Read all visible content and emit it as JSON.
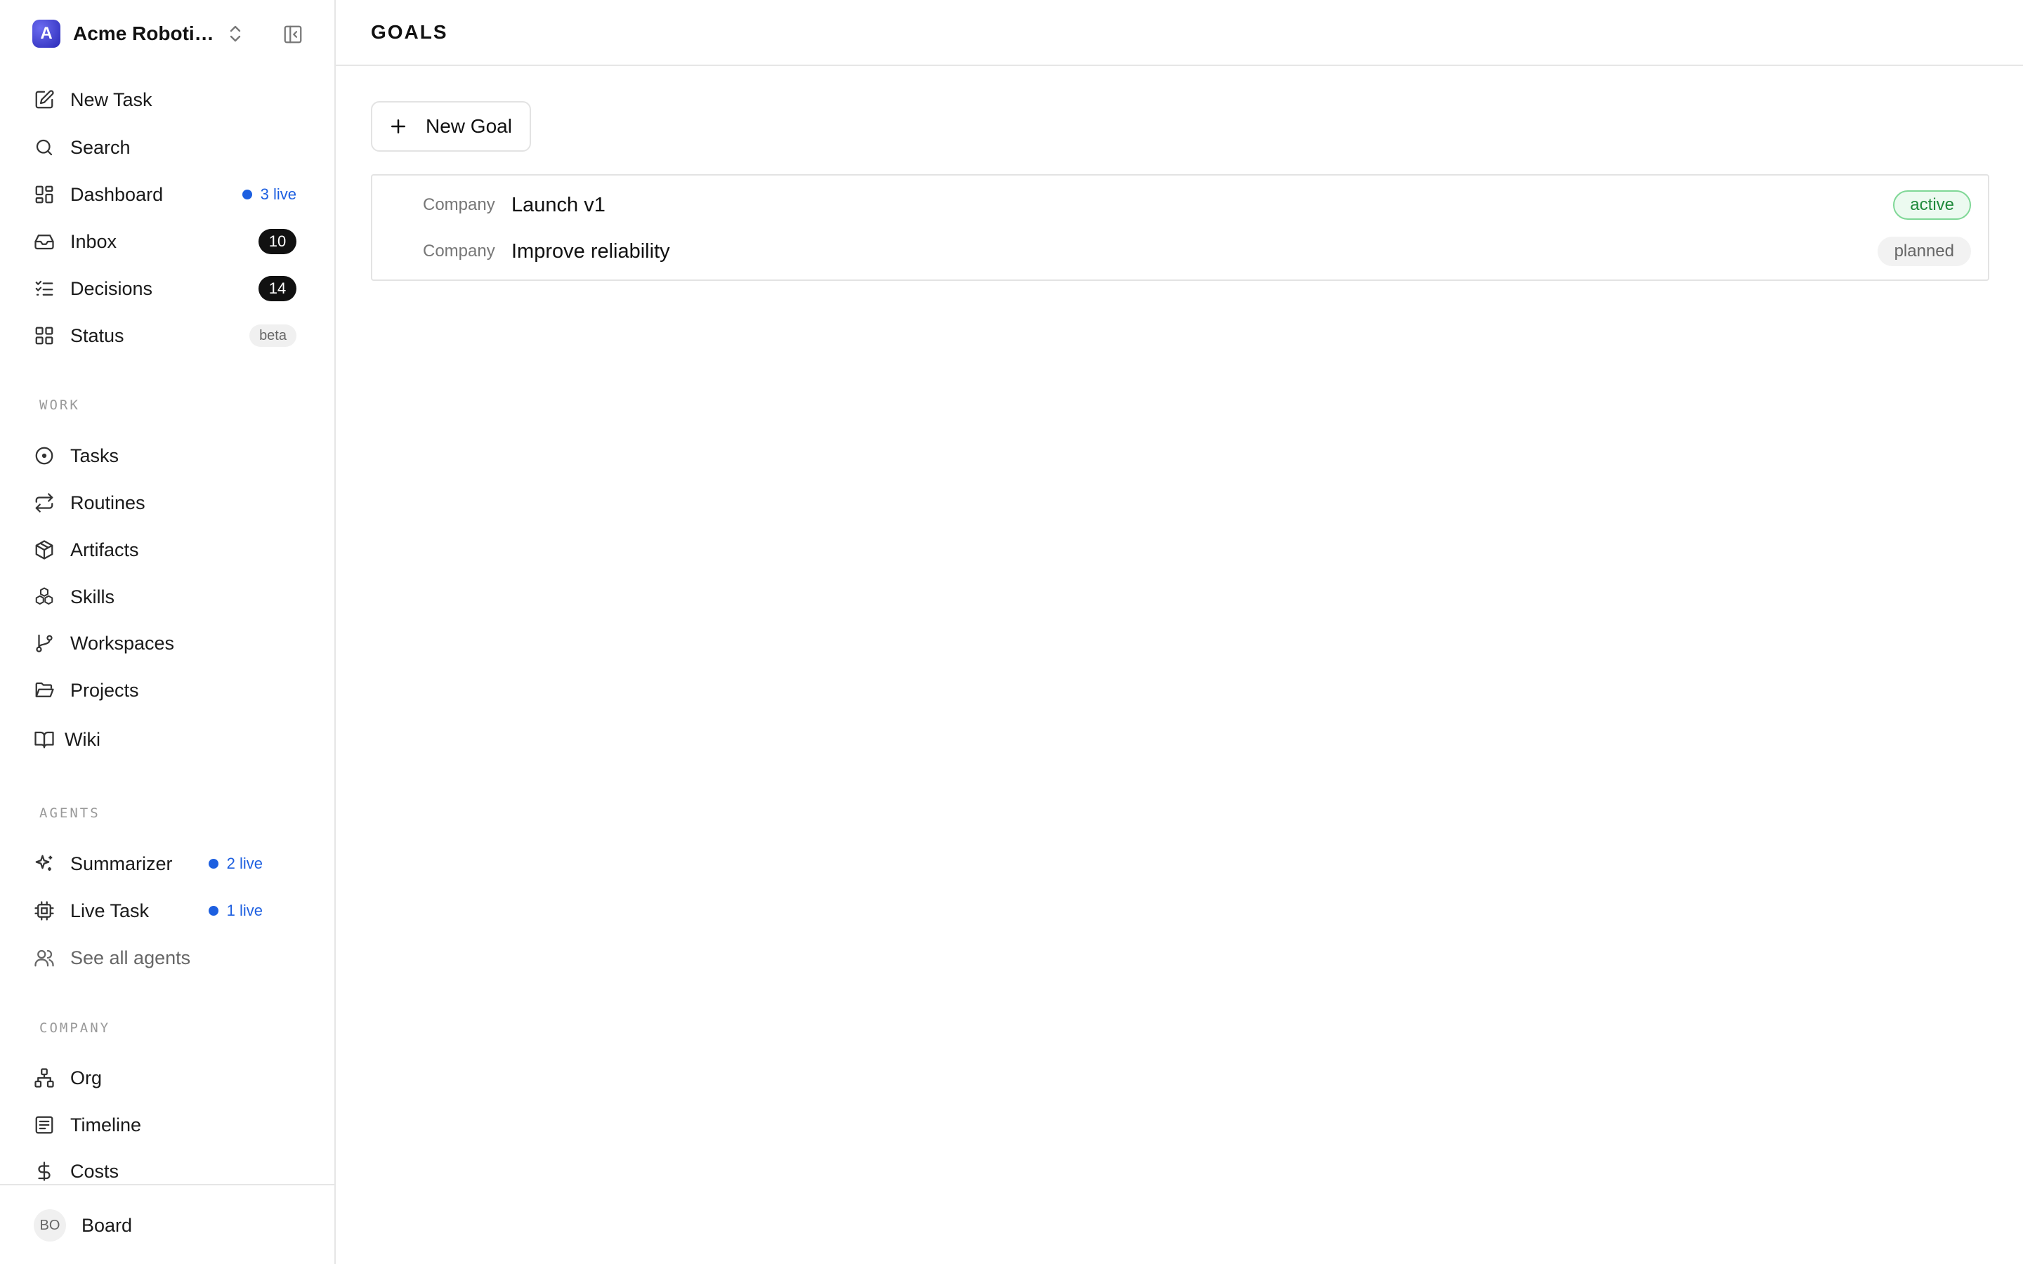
{
  "workspace": {
    "initial": "A",
    "name": "Acme Roboti…"
  },
  "nav": {
    "new_task": "New Task",
    "search": "Search",
    "dashboard": "Dashboard",
    "dashboard_live": "3 live",
    "inbox": "Inbox",
    "inbox_count": "10",
    "decisions": "Decisions",
    "decisions_count": "14",
    "status": "Status",
    "status_badge": "beta"
  },
  "work": {
    "section_label": "WORK",
    "tasks": "Tasks",
    "routines": "Routines",
    "artifacts": "Artifacts",
    "skills": "Skills",
    "workspaces": "Workspaces",
    "projects": "Projects",
    "wiki": "Wiki"
  },
  "agents": {
    "section_label": "AGENTS",
    "summarizer": "Summarizer",
    "summarizer_live": "2 live",
    "live_task": "Live Task",
    "live_task_live": "1 live",
    "see_all": "See all agents"
  },
  "company": {
    "section_label": "COMPANY",
    "org": "Org",
    "timeline": "Timeline",
    "costs": "Costs"
  },
  "user": {
    "initials": "BO",
    "name": "Board"
  },
  "page": {
    "title": "GOALS",
    "new_goal_label": "New Goal"
  },
  "goals": [
    {
      "level": "Company",
      "title": "Launch v1",
      "status": "active"
    },
    {
      "level": "Company",
      "title": "Improve reliability",
      "status": "planned"
    }
  ],
  "colors": {
    "accent_blue": "#1d5fe0",
    "active_green": "#1f8a3b",
    "logo_purple": "#3b3bd0"
  }
}
